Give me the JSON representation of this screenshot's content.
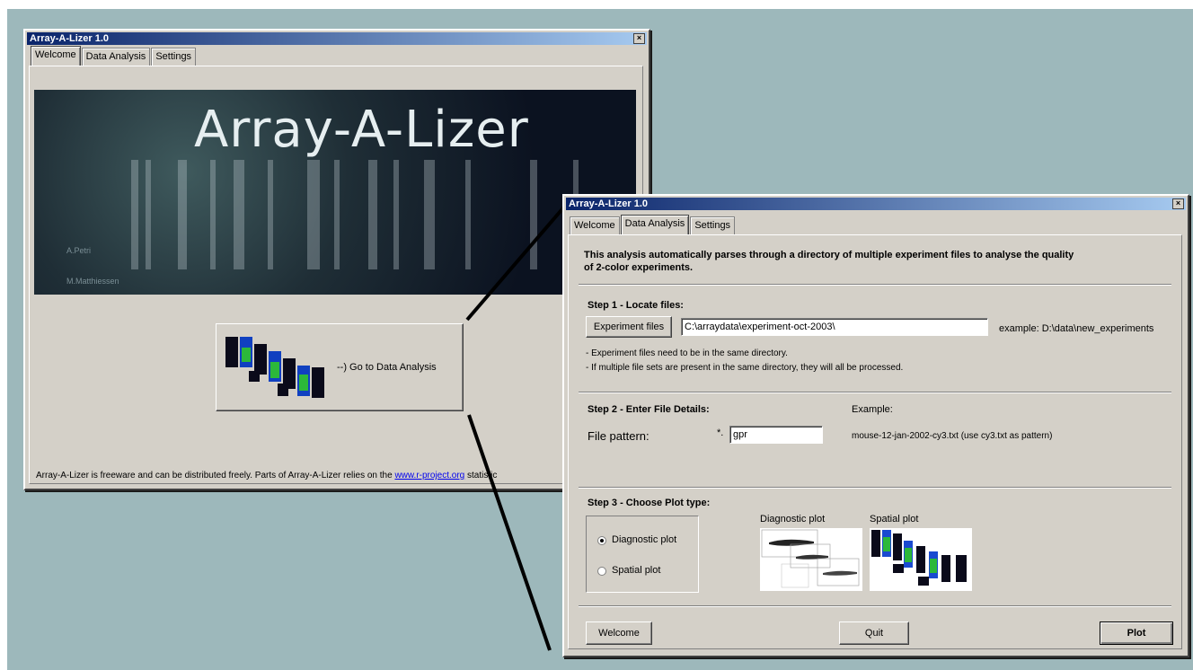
{
  "back_window": {
    "title": "Array-A-Lizer 1.0",
    "tabs": [
      "Welcome",
      "Data Analysis",
      "Settings"
    ],
    "active_tab": 0,
    "banner": {
      "title": "Array-A-Lizer",
      "credits": [
        "A.Petri",
        "M.Matthiessen"
      ]
    },
    "go_button_label": "--) Go to Data Analysis",
    "footer": {
      "text_before": "Array-A-Lizer is freeware and can be distributed freely. Parts of Array-A-Lizer relies on the ",
      "link": "www.r-project.org",
      "text_after": " statistic"
    }
  },
  "front_window": {
    "title": "Array-A-Lizer 1.0",
    "tabs": [
      "Welcome",
      "Data Analysis",
      "Settings"
    ],
    "active_tab": 1,
    "intro_line1": "This analysis automatically parses through a directory of multiple experiment files to analyse the quality",
    "intro_line2": "of 2-color experiments.",
    "step1": {
      "heading": "Step 1 - Locate files:",
      "button": "Experiment files",
      "path_value": "C:\\arraydata\\experiment-oct-2003\\",
      "example": "example: D:\\data\\new_experiments",
      "note1": "- Experiment files need to be in the same directory.",
      "note2": "- If multiple file sets are present in the same directory, they will all be processed."
    },
    "step2": {
      "heading": "Step 2 - Enter File Details:",
      "example_heading": "Example:",
      "pattern_label": "File pattern:",
      "pattern_prefix": "*.",
      "pattern_value": "gpr",
      "example_text": "mouse-12-jan-2002-cy3.txt   (use cy3.txt as pattern)"
    },
    "step3": {
      "heading": "Step 3 - Choose Plot type:",
      "options": [
        "Diagnostic plot",
        "Spatial plot"
      ],
      "selected": 0,
      "thumb_labels": [
        "Diagnostic plot",
        "Spatial plot"
      ]
    },
    "buttons": {
      "welcome": "Welcome",
      "quit": "Quit",
      "plot": "Plot"
    }
  },
  "colors": {
    "desktop": "#9db8bb",
    "face": "#d4d0c8",
    "title_start": "#0a246a",
    "title_end": "#a6caf0"
  }
}
